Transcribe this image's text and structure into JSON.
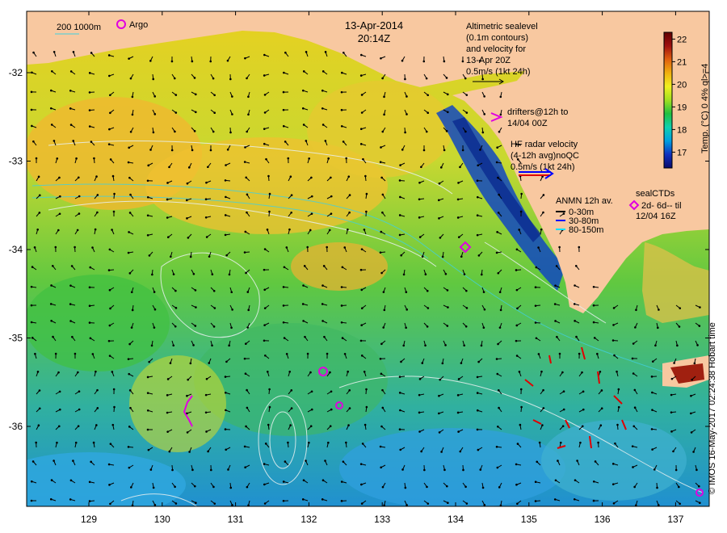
{
  "title": {
    "date": "13-Apr-2014",
    "time": "20:14Z"
  },
  "legend": {
    "isobaths": "200  1000m",
    "argo": "Argo",
    "altimetry": [
      "Altimetric sealevel",
      "(0.1m contours)",
      "and velocity for",
      "13-Apr 20Z",
      "0.5m/s (1kt 24h)"
    ],
    "drifters": [
      "drifters@12h to",
      "14/04 00Z"
    ],
    "hf_radar": [
      "HF radar velocity",
      "(4-12h avg)noQC",
      "0.5m/s (1kt 24h)"
    ],
    "anmn": {
      "title": "ANMN 12h av.",
      "items": [
        {
          "label": "0-30m",
          "color": "#000000"
        },
        {
          "label": "30-80m",
          "color": "#0000ff"
        },
        {
          "label": "80-150m",
          "color": "#00e0ff"
        }
      ]
    },
    "sealctds": [
      "sealCTDs",
      "2d- 6d-- til",
      "12/04 16Z"
    ]
  },
  "colorbar": {
    "label": "Temp. (°C) 0 4% ql>=4",
    "ticks": [
      "17",
      "18",
      "19",
      "20",
      "21",
      "22"
    ],
    "range": [
      16.3,
      22.3
    ],
    "colors": [
      "#0a0a6a",
      "#1030c0",
      "#00a0e0",
      "#10d0b0",
      "#20c040",
      "#a0e020",
      "#f0f020",
      "#f0b010",
      "#e06010",
      "#a01010",
      "#600000"
    ]
  },
  "axes": {
    "x_ticks": [
      "129",
      "130",
      "131",
      "132",
      "133",
      "134",
      "135",
      "136",
      "137"
    ],
    "y_ticks": [
      "-32",
      "-33",
      "-34",
      "-35",
      "-36"
    ]
  },
  "credit": "© IMOS 16-May-2017 02:24:38 Hobart time",
  "colors": {
    "land": "#f8c8a0",
    "warm": "#f0c030",
    "mid": "#48c848",
    "cool": "#30b0e0",
    "coast": "#0a3aa8",
    "argo": "#e000e0"
  }
}
